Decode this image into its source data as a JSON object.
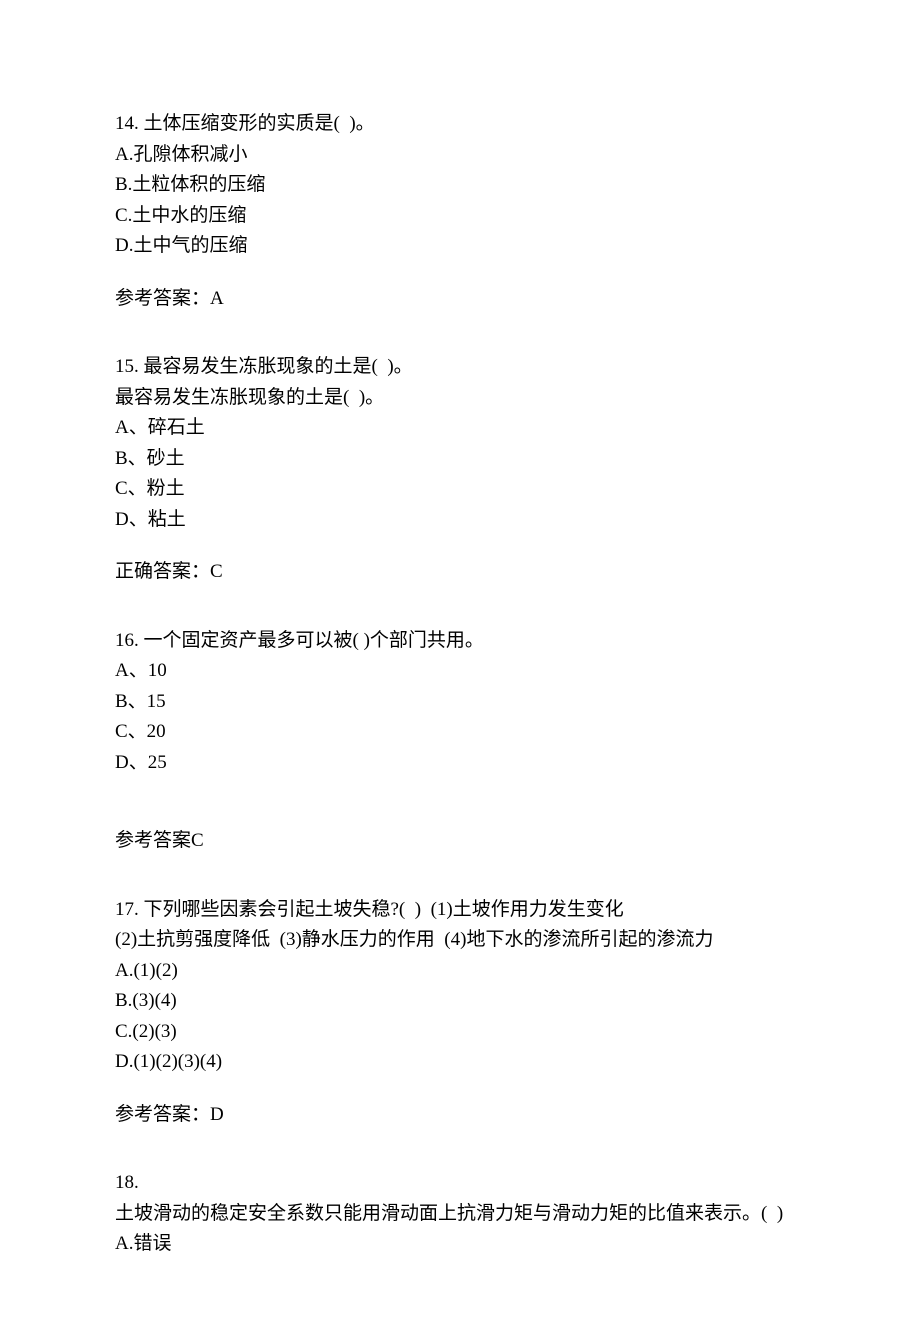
{
  "questions": [
    {
      "number": "14.",
      "stem": "土体压缩变形的实质是(  )。",
      "options": [
        "A.孔隙体积减小",
        "B.土粒体积的压缩",
        "C.土中水的压缩",
        "D.土中气的压缩"
      ],
      "answer_label": "参考答案：A"
    },
    {
      "number": "15.",
      "stem": "最容易发生冻胀现象的土是(  )。",
      "stem2": "最容易发生冻胀现象的土是(  )。",
      "options": [
        "A、碎石土",
        "B、砂土",
        "C、粉土",
        "D、粘土"
      ],
      "answer_label": "正确答案：C"
    },
    {
      "number": "16.",
      "stem": "一个固定资产最多可以被( )个部门共用。",
      "options": [
        "A、10",
        "B、15",
        "C、20",
        "D、25"
      ],
      "answer_label": "参考答案C"
    },
    {
      "number": "17.",
      "stem": "下列哪些因素会引起土坡失稳?(  )  (1)土坡作用力发生变化",
      "stem2": "(2)土抗剪强度降低  (3)静水压力的作用  (4)地下水的渗流所引起的渗流力",
      "options": [
        "A.(1)(2)",
        "B.(3)(4)",
        "C.(2)(3)",
        "D.(1)(2)(3)(4)"
      ],
      "answer_label": "参考答案：D"
    },
    {
      "number": "18.",
      "stem": "土坡滑动的稳定安全系数只能用滑动面上抗滑力矩与滑动力矩的比值来表示。(  )",
      "options": [
        "A.错误"
      ]
    }
  ]
}
